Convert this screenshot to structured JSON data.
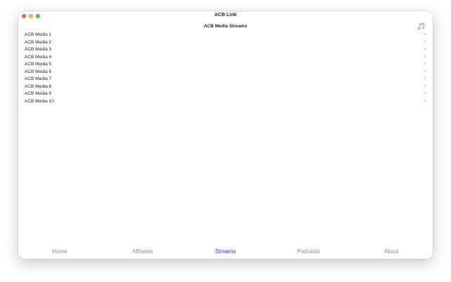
{
  "window": {
    "title": "ACB Link"
  },
  "page": {
    "title": "ACB Media Streams",
    "music_icon": "music-note-icon"
  },
  "streams": [
    {
      "label": "ACB Media 1"
    },
    {
      "label": "ACB Media 2"
    },
    {
      "label": "ACB Media 3"
    },
    {
      "label": "ACB Media 4"
    },
    {
      "label": "ACB Media 5"
    },
    {
      "label": "ACB Media 6"
    },
    {
      "label": "ACB Media 7"
    },
    {
      "label": "ACB Media 8"
    },
    {
      "label": "ACB Media 9"
    },
    {
      "label": "ACB Media 10"
    }
  ],
  "chevron_glyph": ">",
  "tabs": [
    {
      "label": "Home",
      "active": false
    },
    {
      "label": "Affiliates",
      "active": false
    },
    {
      "label": "Streams",
      "active": true
    },
    {
      "label": "Podcasts",
      "active": false
    },
    {
      "label": "About",
      "active": false
    }
  ],
  "colors": {
    "active_tab": "#1f3fd6",
    "inactive_tab": "#8c8c8c",
    "close": "#ed6a5e",
    "minimize": "#f5bf4f",
    "maximize": "#62c655"
  }
}
